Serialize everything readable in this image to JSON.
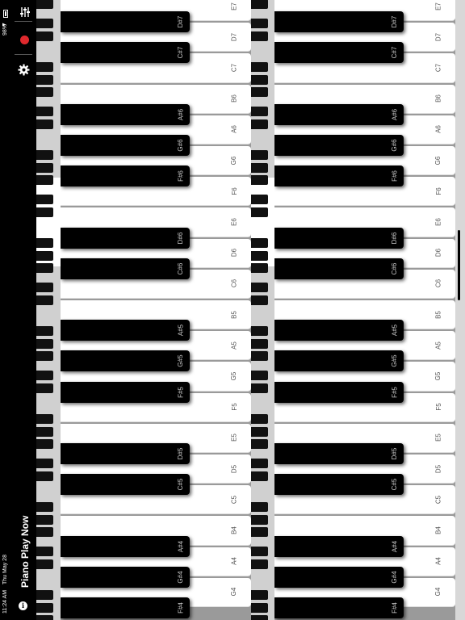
{
  "status_bar": {
    "time": "11:24 AM",
    "date": "Thu May 28",
    "battery": "98%",
    "icons": [
      "battery-icon",
      "wifi-icon"
    ]
  },
  "app": {
    "title": "Piano Play Now",
    "info_symbol": "i"
  },
  "toolbar": {
    "icons": [
      "mixer-icon",
      "record-icon",
      "gear-icon",
      "info-icon"
    ],
    "record_color": "#e0292d"
  },
  "keyboard_1": {
    "white_keys": [
      "E7",
      "D7",
      "C7",
      "B6",
      "A6",
      "G6",
      "F6",
      "E6",
      "D6",
      "C6",
      "B5",
      "A5",
      "G5",
      "F5",
      "E5",
      "D5",
      "C5",
      "B4",
      "A4",
      "G4"
    ],
    "black_keys": [
      "D#7",
      "C#7",
      "A#6",
      "G#6",
      "F#6",
      "D#6",
      "C#6",
      "A#5",
      "G#5",
      "F#5",
      "D#5",
      "C#5",
      "A#4",
      "G#4",
      "F#4"
    ]
  },
  "keyboard_2": {
    "white_keys": [
      "E7",
      "D7",
      "C7",
      "B6",
      "A6",
      "G6",
      "F6",
      "E6",
      "D6",
      "C6",
      "B5",
      "A5",
      "G5",
      "F5",
      "E5",
      "D5",
      "C5",
      "B4",
      "A4",
      "G4"
    ],
    "black_keys": [
      "D#7",
      "C#7",
      "A#6",
      "G#6",
      "F#6",
      "D#6",
      "C#6",
      "A#5",
      "G#5",
      "F#5",
      "D#5",
      "C#5",
      "A#4",
      "G#4",
      "F#4"
    ]
  }
}
